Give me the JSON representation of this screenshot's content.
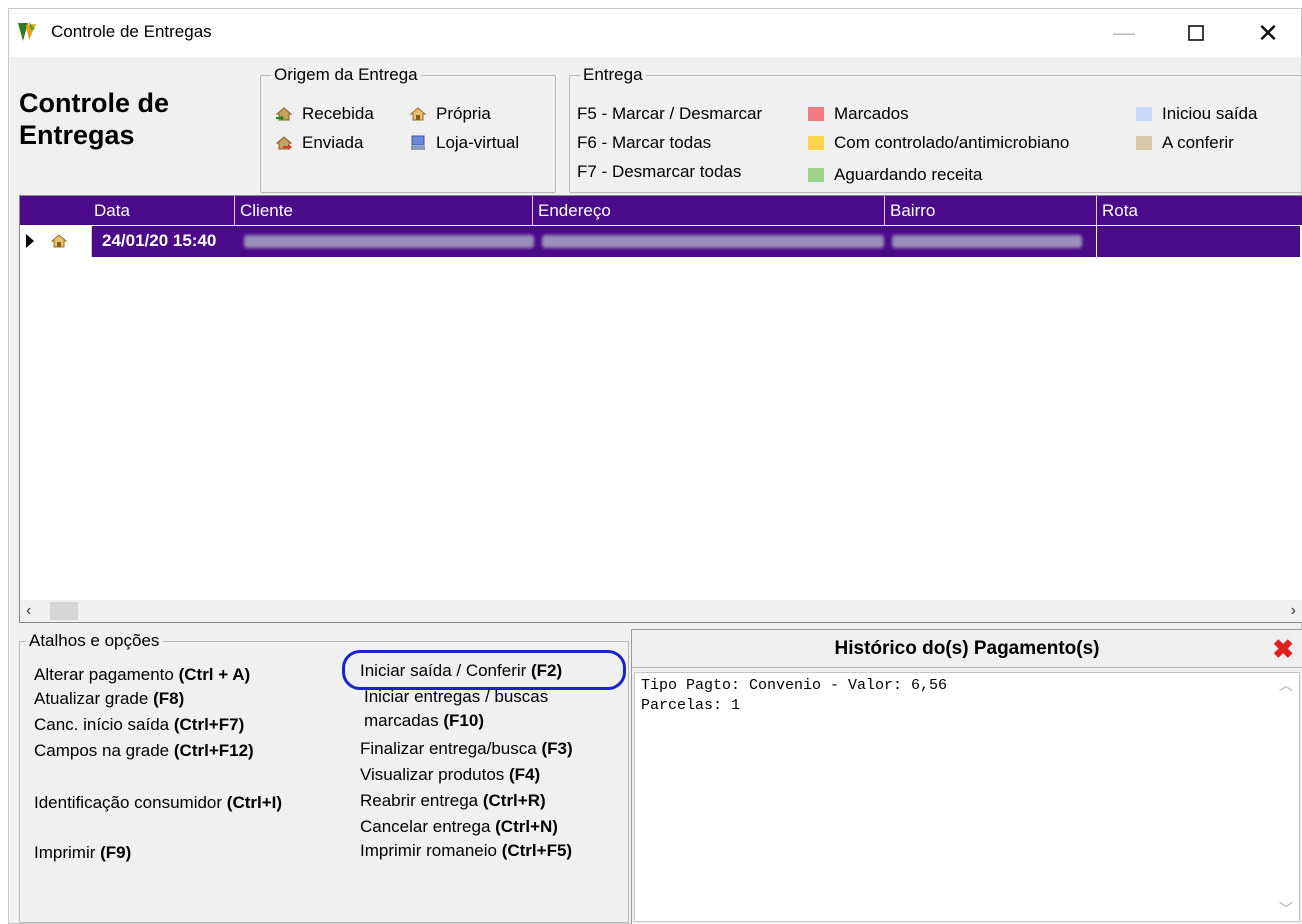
{
  "window": {
    "title": "Controle de Entregas"
  },
  "header": {
    "big_title_line1": "Controle de",
    "big_title_line2": "Entregas"
  },
  "origem": {
    "legend": "Origem da Entrega",
    "items": [
      {
        "label": "Recebida",
        "icon": "house-arrow-icon"
      },
      {
        "label": "Própria",
        "icon": "house-icon"
      },
      {
        "label": "Enviada",
        "icon": "house-send-icon"
      },
      {
        "label": "Loja-virtual",
        "icon": "computer-icon"
      }
    ]
  },
  "entrega": {
    "legend": "Entrega",
    "keys": [
      "F5 - Marcar / Desmarcar",
      "F6 - Marcar todas",
      "F7 - Desmarcar todas"
    ],
    "status": [
      {
        "label": "Marcados",
        "color": "#f07a80"
      },
      {
        "label": "Com controlado/antimicrobiano",
        "color": "#fbd44a"
      },
      {
        "label": "Aguardando receita",
        "color": "#9ed48a"
      },
      {
        "label": "Iniciou saída",
        "color": "#c8d8f8"
      },
      {
        "label": "A conferir",
        "color": "#d8c8a8"
      }
    ]
  },
  "grid": {
    "columns": [
      "Data",
      "Cliente",
      "Endereço",
      "Bairro",
      "Rota"
    ],
    "rows": [
      {
        "data": "24/01/20 15:40"
      }
    ]
  },
  "atalhos": {
    "legend": "Atalhos e opções",
    "left": [
      {
        "text": "Alterar pagamento ",
        "key": "(Ctrl + A)"
      },
      {
        "text": "Atualizar grade  ",
        "key": "(F8)"
      },
      {
        "text": "Canc. início saída ",
        "key": "(Ctrl+F7)"
      },
      {
        "text": "Campos na grade ",
        "key": "(Ctrl+F12)"
      },
      {
        "text": "Identificação consumidor ",
        "key": "(Ctrl+I)"
      },
      {
        "text": "Imprimir  ",
        "key": "(F9)"
      }
    ],
    "right": [
      {
        "text": "Iniciar saída / Conferir  ",
        "key": "(F2)"
      },
      {
        "text": "Iniciar entregas / buscas",
        "key": ""
      },
      {
        "text": "marcadas  ",
        "key": "(F10)"
      },
      {
        "text": "Finalizar entrega/busca ",
        "key": "(F3)"
      },
      {
        "text": "Visualizar produtos  ",
        "key": "(F4)"
      },
      {
        "text": "Reabrir entrega  ",
        "key": "(Ctrl+R)"
      },
      {
        "text": "Cancelar entrega  ",
        "key": "(Ctrl+N)"
      },
      {
        "text": "Imprimir romaneio ",
        "key": "(Ctrl+F5)"
      }
    ]
  },
  "historico": {
    "title": "Histórico do(s) Pagamento(s)",
    "lines": [
      "Tipo Pagto: Convenio - Valor: 6,56",
      "Parcelas: 1"
    ]
  }
}
